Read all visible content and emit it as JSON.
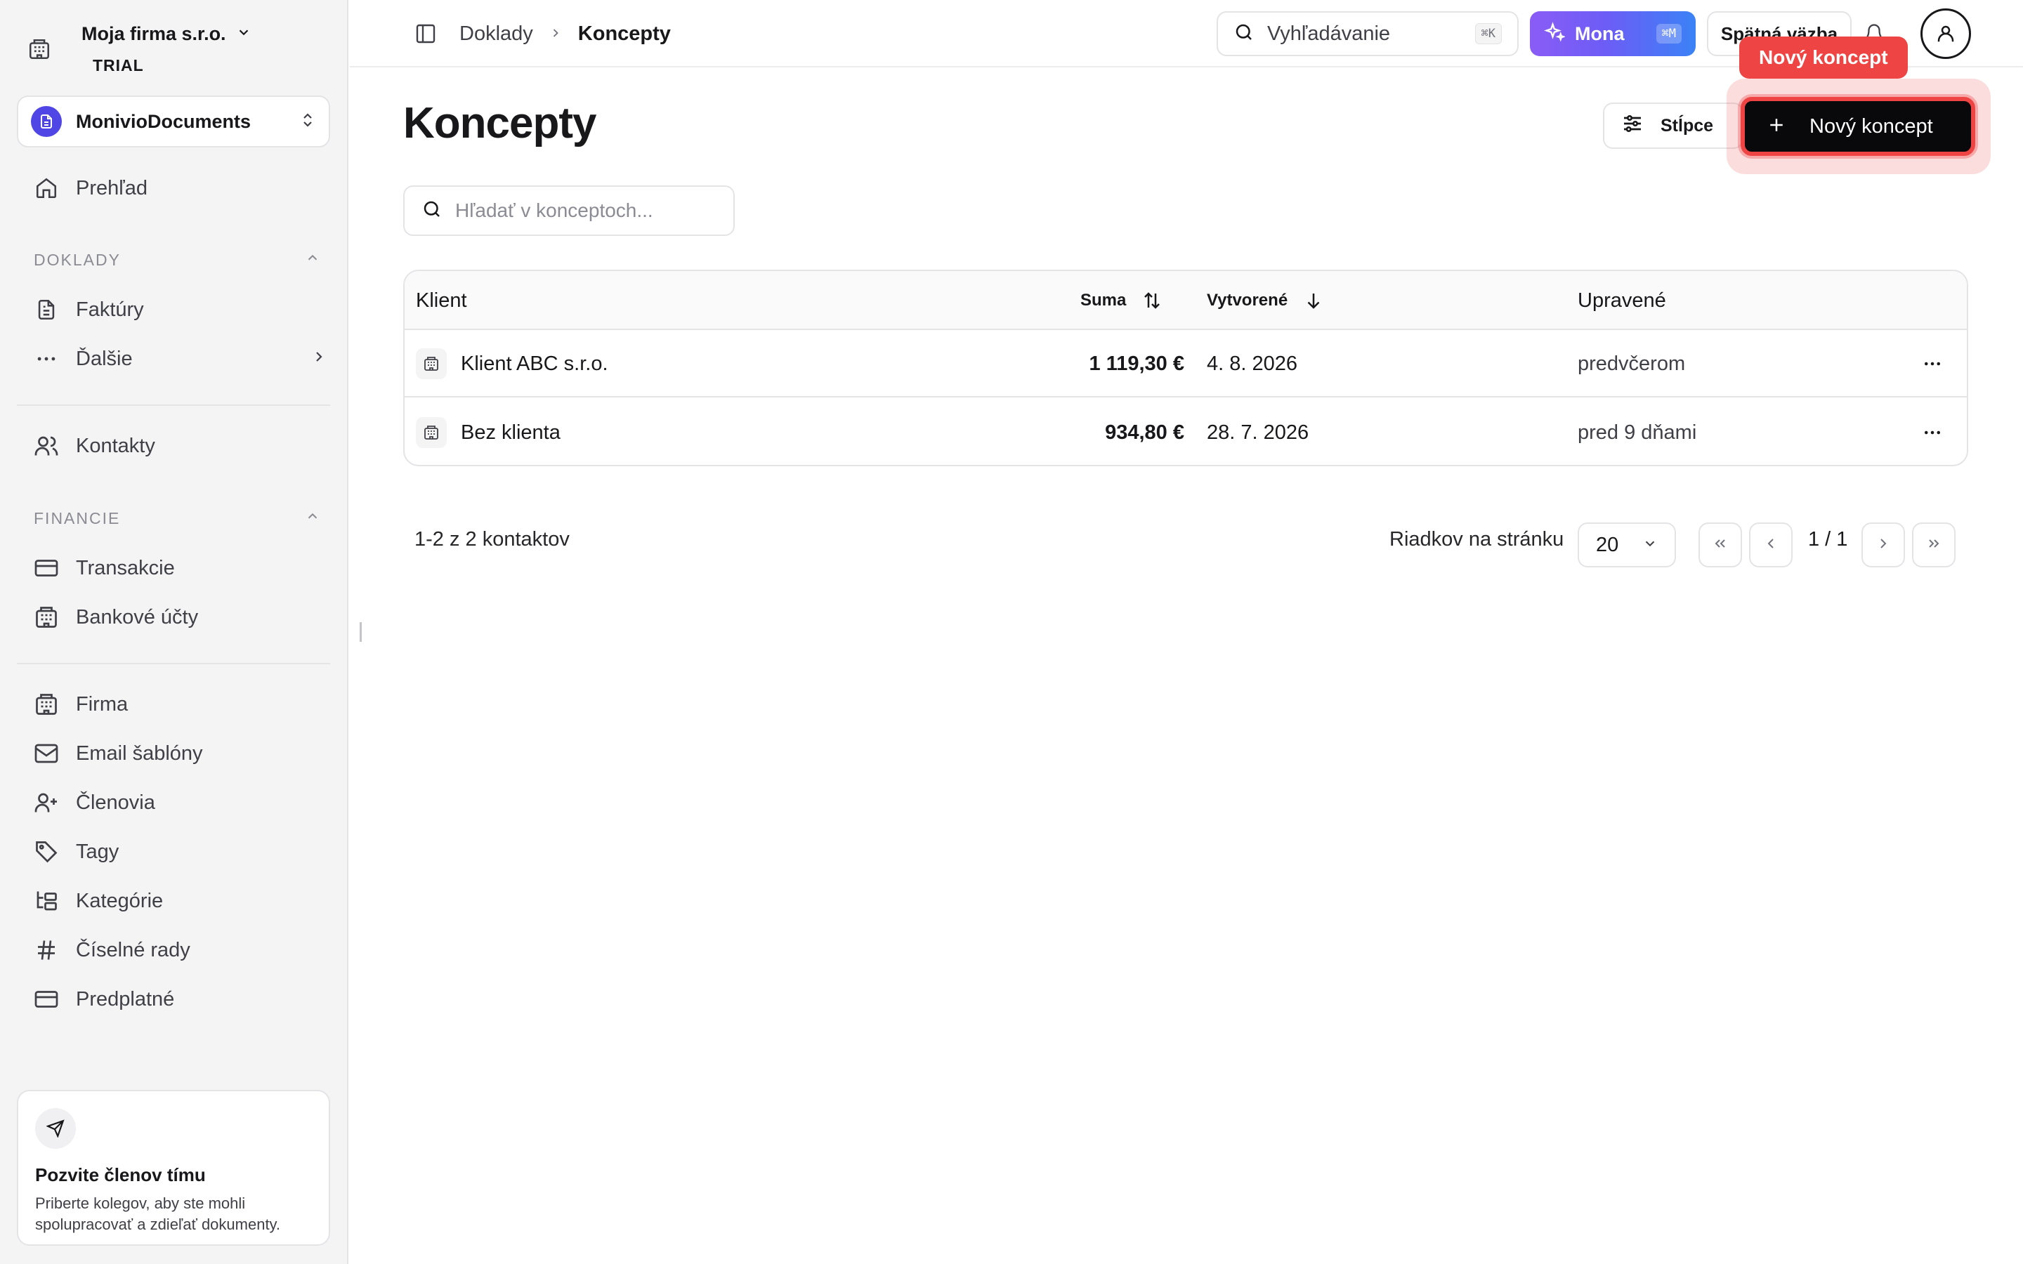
{
  "company": {
    "name": "Moja firma s.r.o.",
    "plan": "TRIAL"
  },
  "app_switcher": {
    "label": "MonivioDocuments"
  },
  "sidebar": {
    "overview": "Prehľad",
    "sections": {
      "documents": "DOKLADY",
      "finance": "FINANCIE"
    },
    "documents_items": [
      "Faktúry",
      "Ďalšie"
    ],
    "contacts": "Kontakty",
    "finance_items": [
      "Transakcie",
      "Bankové účty"
    ],
    "settings_items": [
      "Firma",
      "Email šablóny",
      "Členovia",
      "Tagy",
      "Kategórie",
      "Číselné rady",
      "Predplatné"
    ],
    "invite": {
      "title": "Pozvite členov tímu",
      "description": "Priberte kolegov, aby ste mohli spolupracovať a zdieľať dokumenty."
    }
  },
  "topbar": {
    "breadcrumb": [
      "Doklady",
      "Koncepty"
    ],
    "search_label": "Vyhľadávanie",
    "search_shortcut": "⌘K",
    "mona_label": "Mona",
    "mona_shortcut": "⌘M",
    "feedback_label": "Spätná väzba"
  },
  "page": {
    "title": "Koncepty",
    "columns_button": "Stĺpce",
    "new_button": "Nový koncept",
    "tooltip": "Nový koncept",
    "search_placeholder": "Hľadať v konceptoch..."
  },
  "table": {
    "headers": {
      "client": "Klient",
      "amount": "Suma",
      "created": "Vytvorené",
      "updated": "Upravené"
    },
    "rows": [
      {
        "client": "Klient ABC s.r.o.",
        "amount": "1 119,30 €",
        "created": "4. 8. 2026",
        "updated": "predvčerom"
      },
      {
        "client": "Bez klienta",
        "amount": "934,80 €",
        "created": "28. 7. 2026",
        "updated": "pred 9 dňami"
      }
    ]
  },
  "pagination": {
    "count_text": "1-2 z 2 kontaktov",
    "rows_label": "Riadkov na stránku",
    "rows_value": "20",
    "page_info": "1 / 1"
  },
  "colors": {
    "accent": "#ef4444",
    "primary": "#09090b",
    "brand": "#4f46e5"
  }
}
